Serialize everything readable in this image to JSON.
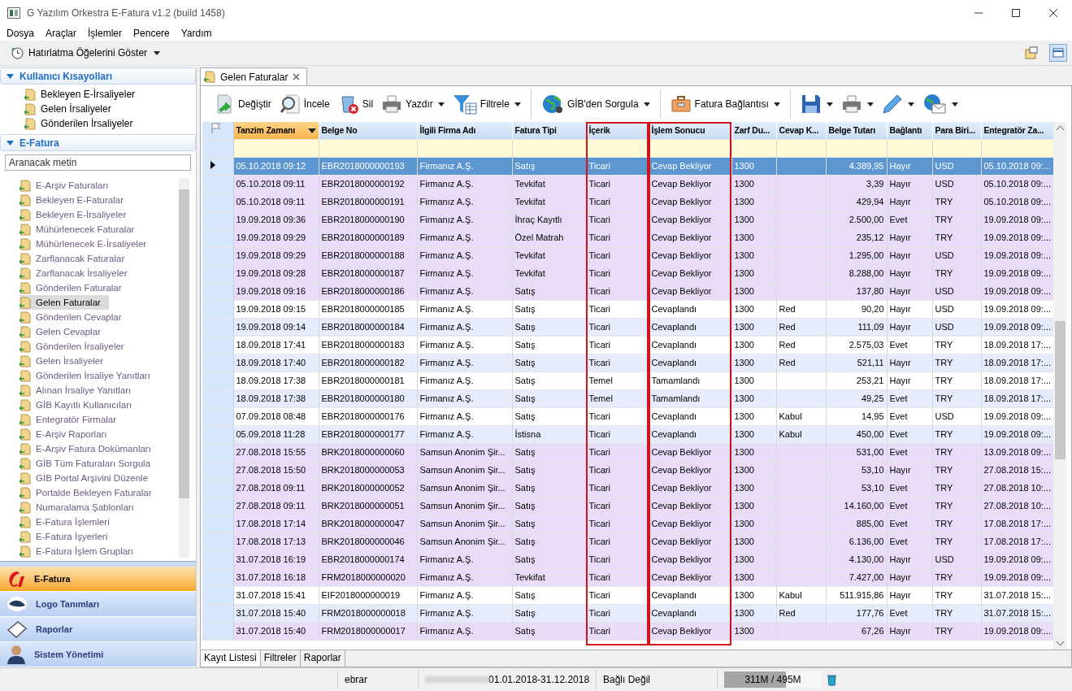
{
  "window": {
    "title": "G Yazılım Orkestra E-Fatura v1.2 (build 1458)"
  },
  "menu": [
    "Dosya",
    "Araçlar",
    "İşlemler",
    "Pencere",
    "Yardım"
  ],
  "top_toolbar": {
    "label": "Hatırlatma Öğelerini Göster"
  },
  "sidebar": {
    "shortcuts": {
      "title": "Kullanıcı Kısayolları",
      "expanded": true,
      "items": [
        "Bekleyen E-İrsaliyeler",
        "Gelen İrsaliyeler",
        "Gönderilen İrsaliyeler"
      ]
    },
    "efatura": {
      "title": "E-Fatura",
      "expanded": true,
      "search": {
        "placeholder": "Aranacak metin"
      },
      "items": [
        {
          "label": "E-Arşiv Faturaları",
          "selected": false
        },
        {
          "label": "Bekleyen E-Faturalar",
          "selected": false
        },
        {
          "label": "Bekleyen E-İrsaliyeler",
          "selected": false
        },
        {
          "label": "Mühürlenecek Faturalar",
          "selected": false
        },
        {
          "label": "Mühürlenecek E-İrsaliyeler",
          "selected": false
        },
        {
          "label": "Zarflanacak Faturalar",
          "selected": false
        },
        {
          "label": "Zarflanacak İrsaliyeler",
          "selected": false
        },
        {
          "label": "Gönderilen Faturalar",
          "selected": false
        },
        {
          "label": "Gelen Faturalar",
          "selected": true
        },
        {
          "label": "Gönderilen Cevaplar",
          "selected": false
        },
        {
          "label": "Gelen Cevaplar",
          "selected": false
        },
        {
          "label": "Gönderilen İrsaliyeler",
          "selected": false
        },
        {
          "label": "Gelen İrsaliyeler",
          "selected": false
        },
        {
          "label": "Gönderilen İrsaliye Yanıtları",
          "selected": false
        },
        {
          "label": "Alınan İrsaliye Yanıtları",
          "selected": false
        },
        {
          "label": "GİB Kayıtlı Kullanıcıları",
          "selected": false
        },
        {
          "label": "Entegratör Firmalar",
          "selected": false
        },
        {
          "label": "E-Arşiv Raporları",
          "selected": false
        },
        {
          "label": "E-Arşiv Fatura Dokümanları",
          "selected": false
        },
        {
          "label": "GİB Tüm Faturaları Sorgula",
          "selected": false
        },
        {
          "label": "GİB Portal Arşivini Düzenle",
          "selected": false
        },
        {
          "label": "Portalde Bekleyen Faturalar",
          "selected": false
        },
        {
          "label": "Numaralama Şablonları",
          "selected": false
        },
        {
          "label": "E-Fatura İşlemleri",
          "selected": false
        },
        {
          "label": "E-Fatura İşyerleri",
          "selected": false
        },
        {
          "label": "E-Fatura İşlem Grupları",
          "selected": false
        }
      ]
    },
    "modules": [
      {
        "label": "E-Fatura",
        "selected": true
      },
      {
        "label": "Logo Tanımları",
        "selected": false
      },
      {
        "label": "Raporlar",
        "selected": false
      },
      {
        "label": "Sistem Yönetimi",
        "selected": false
      }
    ]
  },
  "tab": {
    "label": "Gelen Faturalar"
  },
  "toolbar": [
    {
      "kind": "button",
      "label": "Değiştir",
      "dropdown": false
    },
    {
      "kind": "button",
      "label": "İncele",
      "dropdown": false
    },
    {
      "kind": "button",
      "label": "Sil",
      "dropdown": false
    },
    {
      "kind": "button",
      "label": "Yazdır",
      "dropdown": true
    },
    {
      "kind": "button",
      "label": "Filtrele",
      "dropdown": true
    },
    {
      "kind": "separator"
    },
    {
      "kind": "button",
      "label": "GİB'den Sorgula",
      "dropdown": true
    },
    {
      "kind": "separator"
    },
    {
      "kind": "button",
      "label": "Fatura Bağlantısı",
      "dropdown": true
    },
    {
      "kind": "separator"
    },
    {
      "kind": "button",
      "dropdown": true
    },
    {
      "kind": "button",
      "dropdown": true
    },
    {
      "kind": "button",
      "dropdown": true
    },
    {
      "kind": "button",
      "dropdown": true
    }
  ],
  "table": {
    "columns": [
      {
        "label": "Tanzim Zamanı",
        "sorted": true,
        "outlined": false
      },
      {
        "label": "Belge No",
        "sorted": false,
        "outlined": false
      },
      {
        "label": "İlgili Firma Adı",
        "sorted": false,
        "outlined": false
      },
      {
        "label": "Fatura Tipi",
        "sorted": false,
        "outlined": false
      },
      {
        "label": "İçerik",
        "sorted": false,
        "outlined": true
      },
      {
        "label": "İşlem Sonucu",
        "sorted": false,
        "outlined": true
      },
      {
        "label": "Zarf Du...",
        "sorted": false,
        "outlined": false
      },
      {
        "label": "Cevap K...",
        "sorted": false,
        "outlined": false
      },
      {
        "label": "Belge Tutarı",
        "sorted": false,
        "outlined": false
      },
      {
        "label": "Bağlantı",
        "sorted": false,
        "outlined": false
      },
      {
        "label": "Para Biri...",
        "sorted": false,
        "outlined": false
      },
      {
        "label": "Entegratör Za...",
        "sorted": false,
        "outlined": false
      }
    ],
    "rows": [
      {
        "selected": true,
        "cells": [
          "05.10.2018 09:12",
          "EBR2018000000193",
          "Firmanız A.Ş.",
          "Satış",
          "Ticari",
          "Cevap Bekliyor",
          "1300",
          "",
          "4.389,95",
          "Hayır",
          "USD",
          "05.10.2018 09:..."
        ]
      },
      {
        "selected": false,
        "highlighted": true,
        "cells": [
          "05.10.2018 09:11",
          "EBR2018000000192",
          "Firmanız A.Ş.",
          "Tevkifat",
          "Ticari",
          "Cevap Bekliyor",
          "1300",
          "",
          "3,39",
          "Hayır",
          "USD",
          "05.10.2018 09:..."
        ]
      },
      {
        "selected": false,
        "highlighted": true,
        "cells": [
          "05.10.2018 09:11",
          "EBR2018000000191",
          "Firmanız A.Ş.",
          "Tevkifat",
          "Ticari",
          "Cevap Bekliyor",
          "1300",
          "",
          "429,94",
          "Hayır",
          "TRY",
          "05.10.2018 09:..."
        ]
      },
      {
        "selected": false,
        "highlighted": true,
        "cells": [
          "19.09.2018 09:36",
          "EBR2018000000190",
          "Firmanız A.Ş.",
          "İhraç Kayıtlı",
          "Ticari",
          "Cevap Bekliyor",
          "1300",
          "",
          "2.500,00",
          "Evet",
          "TRY",
          "19.09.2018 09:..."
        ]
      },
      {
        "selected": false,
        "highlighted": true,
        "cells": [
          "19.09.2018 09:29",
          "EBR2018000000189",
          "Firmanız A.Ş.",
          "Özel Matrah",
          "Ticari",
          "Cevap Bekliyor",
          "1300",
          "",
          "235,12",
          "Hayır",
          "TRY",
          "19.09.2018 09:..."
        ]
      },
      {
        "selected": false,
        "highlighted": true,
        "cells": [
          "19.09.2018 09:29",
          "EBR2018000000188",
          "Firmanız A.Ş.",
          "Tevkifat",
          "Ticari",
          "Cevap Bekliyor",
          "1300",
          "",
          "1.295,00",
          "Hayır",
          "USD",
          "19.09.2018 09:..."
        ]
      },
      {
        "selected": false,
        "highlighted": true,
        "cells": [
          "19.09.2018 09:28",
          "EBR2018000000187",
          "Firmanız A.Ş.",
          "Tevkifat",
          "Ticari",
          "Cevap Bekliyor",
          "1300",
          "",
          "8.288,00",
          "Hayır",
          "TRY",
          "19.09.2018 09:..."
        ]
      },
      {
        "selected": false,
        "highlighted": true,
        "cells": [
          "19.09.2018 09:16",
          "EBR2018000000186",
          "Firmanız A.Ş.",
          "Satış",
          "Ticari",
          "Cevap Bekliyor",
          "1300",
          "",
          "137,80",
          "Hayır",
          "USD",
          "19.09.2018 09:..."
        ]
      },
      {
        "selected": false,
        "highlighted": false,
        "cells": [
          "19.09.2018 09:15",
          "EBR2018000000185",
          "Firmanız A.Ş.",
          "Satış",
          "Ticari",
          "Cevaplandı",
          "1300",
          "Red",
          "90,20",
          "Hayır",
          "USD",
          "19.09.2018 09:..."
        ]
      },
      {
        "selected": false,
        "highlighted": false,
        "cells": [
          "19.09.2018 09:14",
          "EBR2018000000184",
          "Firmanız A.Ş.",
          "Satış",
          "Ticari",
          "Cevaplandı",
          "1300",
          "Red",
          "111,09",
          "Hayır",
          "USD",
          "19.09.2018 09:..."
        ]
      },
      {
        "selected": false,
        "highlighted": false,
        "cells": [
          "18.09.2018 17:41",
          "EBR2018000000183",
          "Firmanız A.Ş.",
          "Satış",
          "Ticari",
          "Cevaplandı",
          "1300",
          "Red",
          "2.575,03",
          "Evet",
          "TRY",
          "18.09.2018 17:..."
        ]
      },
      {
        "selected": false,
        "highlighted": false,
        "cells": [
          "18.09.2018 17:40",
          "EBR2018000000182",
          "Firmanız A.Ş.",
          "Satış",
          "Ticari",
          "Cevaplandı",
          "1300",
          "Red",
          "521,11",
          "Hayır",
          "TRY",
          "18.09.2018 17:..."
        ]
      },
      {
        "selected": false,
        "highlighted": false,
        "cells": [
          "18.09.2018 17:38",
          "EBR2018000000181",
          "Firmanız A.Ş.",
          "Satış",
          "Temel",
          "Tamamlandı",
          "1300",
          "",
          "253,21",
          "Hayır",
          "TRY",
          "18.09.2018 17:..."
        ]
      },
      {
        "selected": false,
        "highlighted": false,
        "cells": [
          "18.09.2018 17:38",
          "EBR2018000000180",
          "Firmanız A.Ş.",
          "Satış",
          "Temel",
          "Tamamlandı",
          "1300",
          "",
          "49,25",
          "Evet",
          "TRY",
          "18.09.2018 17:..."
        ]
      },
      {
        "selected": false,
        "highlighted": false,
        "cells": [
          "07.09.2018 08:48",
          "EBR2018000000176",
          "Firmanız A.Ş.",
          "Satış",
          "Ticari",
          "Cevaplandı",
          "1300",
          "Kabul",
          "14,95",
          "Evet",
          "USD",
          "19.09.2018 09:..."
        ]
      },
      {
        "selected": false,
        "highlighted": false,
        "cells": [
          "05.09.2018 11:28",
          "EBR2018000000177",
          "Firmanız A.Ş.",
          "İstisna",
          "Ticari",
          "Cevaplandı",
          "1300",
          "Kabul",
          "450,00",
          "Evet",
          "TRY",
          "19.09.2018 09:..."
        ]
      },
      {
        "selected": false,
        "highlighted": true,
        "cells": [
          "27.08.2018 15:55",
          "BRK2018000000060",
          "Samsun Anonim Şir...",
          "Satış",
          "Ticari",
          "Cevap Bekliyor",
          "1300",
          "",
          "531,00",
          "Evet",
          "TRY",
          "13.09.2018 09:..."
        ]
      },
      {
        "selected": false,
        "highlighted": true,
        "cells": [
          "27.08.2018 15:50",
          "BRK2018000000053",
          "Samsun Anonim Şir...",
          "Satış",
          "Ticari",
          "Cevap Bekliyor",
          "1300",
          "",
          "53,10",
          "Hayır",
          "TRY",
          "27.08.2018 15:..."
        ]
      },
      {
        "selected": false,
        "highlighted": true,
        "cells": [
          "27.08.2018 09:11",
          "BRK2018000000052",
          "Samsun Anonim Şir...",
          "Satış",
          "Ticari",
          "Cevap Bekliyor",
          "1300",
          "",
          "53,10",
          "Evet",
          "TRY",
          "27.08.2018 10:..."
        ]
      },
      {
        "selected": false,
        "highlighted": true,
        "cells": [
          "27.08.2018 09:11",
          "BRK2018000000051",
          "Samsun Anonim Şir...",
          "Satış",
          "Ticari",
          "Cevap Bekliyor",
          "1300",
          "",
          "14.160,00",
          "Evet",
          "TRY",
          "27.08.2018 10:..."
        ]
      },
      {
        "selected": false,
        "highlighted": true,
        "cells": [
          "17.08.2018 17:14",
          "BRK2018000000047",
          "Samsun Anonim Şir...",
          "Satış",
          "Ticari",
          "Cevap Bekliyor",
          "1300",
          "",
          "885,00",
          "Evet",
          "TRY",
          "17.08.2018 17:..."
        ]
      },
      {
        "selected": false,
        "highlighted": true,
        "cells": [
          "17.08.2018 17:13",
          "BRK2018000000046",
          "Samsun Anonim Şir...",
          "Satış",
          "Ticari",
          "Cevap Bekliyor",
          "1300",
          "",
          "6.136,00",
          "Evet",
          "TRY",
          "17.08.2018 17:..."
        ]
      },
      {
        "selected": false,
        "highlighted": true,
        "cells": [
          "31.07.2018 16:19",
          "EBR2018000000174",
          "Firmanız A.Ş.",
          "Satış",
          "Ticari",
          "Cevap Bekliyor",
          "1300",
          "",
          "4.130,00",
          "Hayır",
          "USD",
          "19.09.2018 09:..."
        ]
      },
      {
        "selected": false,
        "highlighted": true,
        "cells": [
          "31.07.2018 16:18",
          "FRM2018000000020",
          "Firmanız A.Ş.",
          "Tevkifat",
          "Ticari",
          "Cevap Bekliyor",
          "1300",
          "",
          "7.427,00",
          "Hayır",
          "TRY",
          "19.09.2018 09:..."
        ]
      },
      {
        "selected": false,
        "highlighted": false,
        "cells": [
          "31.07.2018 15:41",
          "EIF2018000000019",
          "Firmanız A.Ş.",
          "Satış",
          "Ticari",
          "Cevaplandı",
          "1300",
          "Kabul",
          "511.915,86",
          "Hayır",
          "TRY",
          "31.07.2018 15:..."
        ]
      },
      {
        "selected": false,
        "highlighted": false,
        "cells": [
          "31.07.2018 15:40",
          "FRM2018000000018",
          "Firmanız A.Ş.",
          "Satış",
          "Ticari",
          "Cevaplandı",
          "1300",
          "Red",
          "177,76",
          "Evet",
          "TRY",
          "31.07.2018 15:..."
        ]
      },
      {
        "selected": false,
        "highlighted": true,
        "cells": [
          "31.07.2018 15:40",
          "FRM2018000000017",
          "Firmanız A.Ş.",
          "Satış",
          "Ticari",
          "Cevap Bekliyor",
          "1300",
          "",
          "67,26",
          "Hayır",
          "TRY",
          "19.09.2018 09:..."
        ]
      }
    ]
  },
  "bottom_tabs": [
    {
      "label": "Kayıt Listesi",
      "selected": true
    },
    {
      "label": "Filtreler",
      "selected": false
    },
    {
      "label": "Raporlar",
      "selected": false
    }
  ],
  "status_bar": {
    "user": "ebrar",
    "period": "01.01.2018-31.12.2018",
    "connection": "Bağlı Değil",
    "memory": {
      "reading": "311M / 495M",
      "level": 0.63
    }
  }
}
